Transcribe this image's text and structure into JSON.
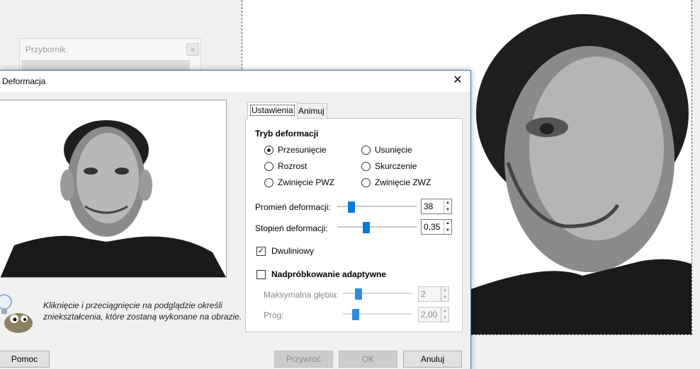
{
  "toolbox": {
    "title": "Przybornik",
    "close": "×"
  },
  "dialog": {
    "title": "Deformacja",
    "close": "✕",
    "hint": "Kliknięcie i przeciągnięcie na podglądzie określi zniekształcenia, które zostaną wykonane na obrazie.",
    "tabs": [
      {
        "label": "Ustawienia",
        "active": true
      },
      {
        "label": "Animuj",
        "active": false
      }
    ],
    "settings": {
      "mode_title": "Tryb deformacji",
      "modes": [
        {
          "label": "Przesunięcie",
          "selected": true
        },
        {
          "label": "Usunięcie",
          "selected": false
        },
        {
          "label": "Rozrost",
          "selected": false
        },
        {
          "label": "Skurczenie",
          "selected": false
        },
        {
          "label": "Zwinięcie PWZ",
          "selected": false
        },
        {
          "label": "Zwinięcie ZWZ",
          "selected": false
        }
      ],
      "radius": {
        "label": "Promień deformacji:",
        "value": "38",
        "level": 0.15
      },
      "amount": {
        "label": "Stopień deformacji:",
        "value": "0,35",
        "level": 0.35
      },
      "bilinear": {
        "label": "Dwuliniowy",
        "checked": true,
        "mark": "✓"
      },
      "supersample": {
        "label": "Nadpróbkowanie adaptywne",
        "checked": false
      },
      "max_depth": {
        "label": "Maksymalna głębia:",
        "value": "2",
        "level": 0.2,
        "enabled": false
      },
      "threshold": {
        "label": "Próg:",
        "value": "2,00",
        "level": 0.15,
        "enabled": false
      }
    },
    "buttons": {
      "help": "Pomoc",
      "reset": "Przywróć",
      "ok": "OK",
      "cancel": "Anuluj"
    }
  },
  "colors": {
    "accent": "#0a79d8",
    "dialog_border": "#3c7fb1"
  },
  "icons": {
    "spin_up": "▲",
    "spin_down": "▼"
  }
}
